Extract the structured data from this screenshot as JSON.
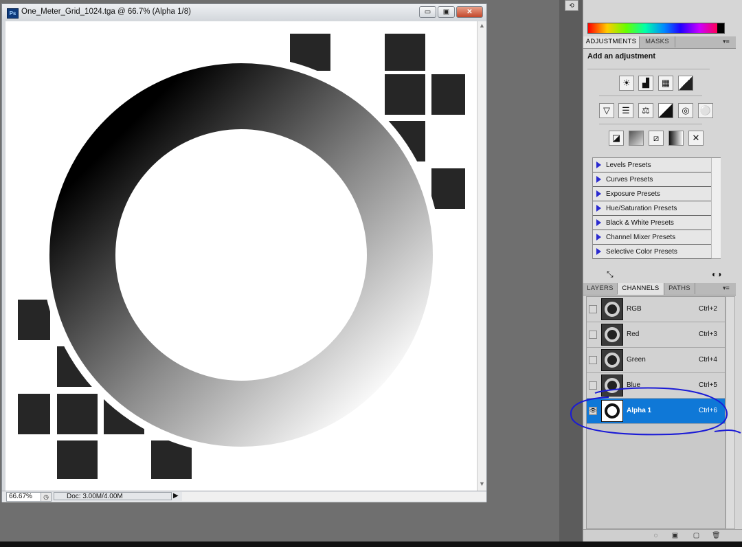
{
  "document": {
    "title": "One_Meter_Grid_1024.tga @ 66.7% (Alpha 1/8)",
    "app_badge": "Ps",
    "window_buttons": {
      "minimize": "▭",
      "restore": "▣",
      "close": "✕"
    },
    "zoom": "66.67%",
    "doc_size": "Doc: 3.00M/4.00M"
  },
  "adjustments_panel": {
    "tabs": [
      "ADJUSTMENTS",
      "MASKS"
    ],
    "heading": "Add an adjustment",
    "icon_rows": [
      [
        "brightness-contrast-icon",
        "levels-icon",
        "curves-icon",
        "exposure-icon"
      ],
      [
        "vibrance-icon",
        "hue-saturation-icon",
        "color-balance-icon",
        "black-white-icon",
        "photo-filter-icon",
        "channel-mixer-icon"
      ],
      [
        "invert-icon",
        "posterize-icon",
        "threshold-icon",
        "gradient-map-icon",
        "selective-color-icon"
      ]
    ],
    "presets": [
      "Levels Presets",
      "Curves Presets",
      "Exposure Presets",
      "Hue/Saturation Presets",
      "Black & White Presets",
      "Channel Mixer Presets",
      "Selective Color Presets"
    ]
  },
  "channels_panel": {
    "tabs": [
      "LAYERS",
      "CHANNELS",
      "PATHS"
    ],
    "active_tab": "CHANNELS",
    "channels": [
      {
        "name": "RGB",
        "shortcut": "Ctrl+2",
        "visible": false,
        "selected": false
      },
      {
        "name": "Red",
        "shortcut": "Ctrl+3",
        "visible": false,
        "selected": false
      },
      {
        "name": "Green",
        "shortcut": "Ctrl+4",
        "visible": false,
        "selected": false
      },
      {
        "name": "Blue",
        "shortcut": "Ctrl+5",
        "visible": false,
        "selected": false
      },
      {
        "name": "Alpha 1",
        "shortcut": "Ctrl+6",
        "visible": true,
        "selected": true
      }
    ]
  },
  "colors": {
    "selection": "#0f78d7",
    "annotation": "#1a1ad6"
  }
}
